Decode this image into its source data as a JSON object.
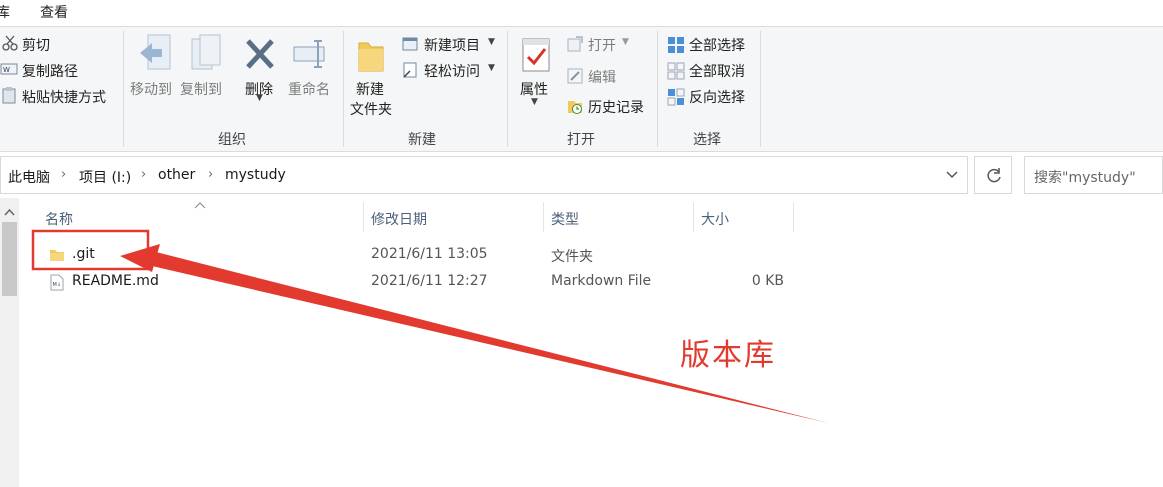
{
  "tabs": [
    {
      "label": "库"
    },
    {
      "label": "查看"
    }
  ],
  "ribbon": {
    "clipboard": {
      "cut": "剪切",
      "copy_path": "复制路径",
      "paste_shortcut": "粘贴快捷方式"
    },
    "organize": {
      "move_to": "移动到",
      "copy_to": "复制到",
      "delete": "删除",
      "rename": "重命名",
      "label": "组织"
    },
    "new": {
      "new_folder_line1": "新建",
      "new_folder_line2": "文件夹",
      "new_item": "新建项目",
      "easy_access": "轻松访问",
      "label": "新建"
    },
    "open": {
      "properties": "属性",
      "open": "打开",
      "edit": "编辑",
      "history": "历史记录",
      "label": "打开"
    },
    "select": {
      "select_all": "全部选择",
      "select_none": "全部取消",
      "invert": "反向选择",
      "label": "选择"
    }
  },
  "address": {
    "parts": [
      "此电脑",
      "项目 (I:)",
      "other",
      "mystudy"
    ]
  },
  "search": {
    "placeholder": "搜索\"mystudy\""
  },
  "columns": {
    "name": "名称",
    "modified": "修改日期",
    "type": "类型",
    "size": "大小"
  },
  "files": [
    {
      "name": ".git",
      "modified": "2021/6/11 13:05",
      "type": "文件夹",
      "size": ""
    },
    {
      "name": "README.md",
      "modified": "2021/6/11 12:27",
      "type": "Markdown File",
      "size": "0 KB"
    }
  ],
  "annotation": {
    "label": "版本库"
  },
  "colors": {
    "annotation": "#e23a2e",
    "folder": "#f3c95c",
    "ribbon_bg": "#f5f6f7"
  }
}
